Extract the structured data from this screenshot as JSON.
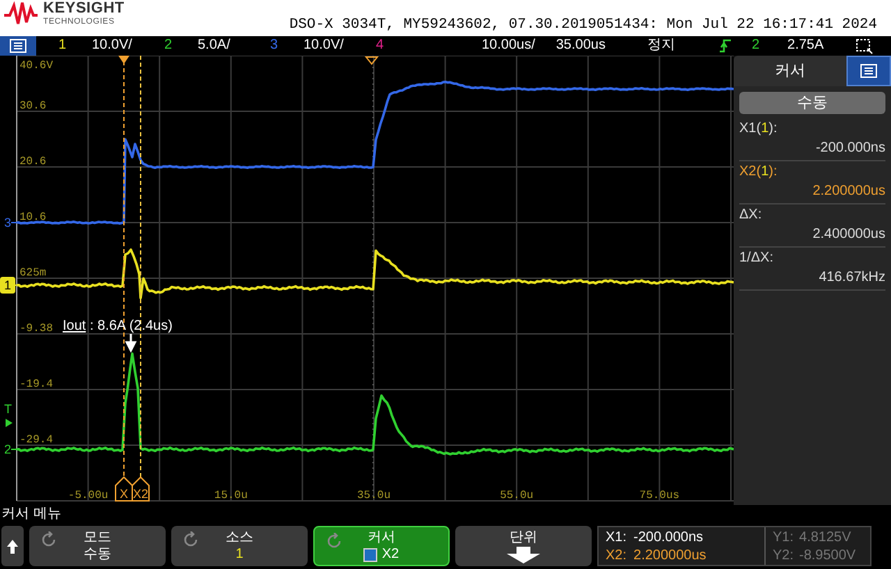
{
  "header": {
    "brand": "KEYSIGHT",
    "brand_sub": "TECHNOLOGIES",
    "title": "DSO-X 3034T, MY59243602, 07.30.2019051434: Mon Jul 22 16:17:41 2024"
  },
  "channels": [
    {
      "number": "1",
      "scale": "10.0V/",
      "color": "#e8e020"
    },
    {
      "number": "2",
      "scale": "5.0A/",
      "color": "#30d030"
    },
    {
      "number": "3",
      "scale": "10.0V/",
      "color": "#3468e8"
    },
    {
      "number": "4",
      "color": "#e0208a"
    }
  ],
  "horizontal": {
    "scale": "10.00us/",
    "delay": "35.00us"
  },
  "run_state": "정지",
  "trigger": {
    "source": "2",
    "level": "2.75A"
  },
  "display": {
    "y_labels": [
      "40.6V",
      "30.6",
      "20.6",
      "10.6",
      "625m",
      "-9.38",
      "-19.4",
      "-29.4"
    ],
    "x_labels": [
      "-5.00u",
      "15.0u",
      "35.0u",
      "55.0u",
      "75.0us"
    ],
    "channel_markers": [
      {
        "label": "3",
        "color": "#3468e8",
        "selected": false
      },
      {
        "label": "1",
        "color": "#e8e020",
        "selected": true
      },
      {
        "label": "2",
        "color": "#30d030",
        "selected": false
      }
    ],
    "trigger_marker": "T",
    "annotation": {
      "underlined": "Iout",
      "rest": " : 8.6A (2.4us)"
    },
    "cursor_markers": [
      "X",
      "X2"
    ]
  },
  "cursor_panel": {
    "title": "커서",
    "mode": "수동",
    "readouts": [
      {
        "prefix": "X1(",
        "source": "1",
        "suffix": "):",
        "value": "-200.000ns",
        "active": false
      },
      {
        "prefix": "X2(",
        "source": "1",
        "suffix": "):",
        "value": "2.200000us",
        "active": true
      },
      {
        "prefix": "ΔX:",
        "value": "2.400000us",
        "active": false
      },
      {
        "prefix": "1/ΔX:",
        "value": "416.67kHz",
        "active": false
      }
    ]
  },
  "menu_title": "커서 메뉴",
  "softkeys": [
    {
      "kind": "cycle",
      "title": "모드",
      "value": "수동",
      "selected": false
    },
    {
      "kind": "cycle",
      "title": "소스",
      "value": "1",
      "color": "#e8e020",
      "selected": false
    },
    {
      "kind": "checkbox",
      "title": "커서",
      "value": "X2",
      "selected": true
    },
    {
      "kind": "submenu",
      "title": "단위",
      "selected": false
    }
  ],
  "readout_box": {
    "x_lines": [
      {
        "label": "X1:",
        "value": "-200.000ns",
        "active": false
      },
      {
        "label": "X2:",
        "value": "2.200000us",
        "active": true
      }
    ],
    "y_lines": [
      {
        "label": "Y1:",
        "value": "4.8125V"
      },
      {
        "label": "Y2:",
        "value": "-8.9500V"
      }
    ],
    "y_disabled": true
  }
}
